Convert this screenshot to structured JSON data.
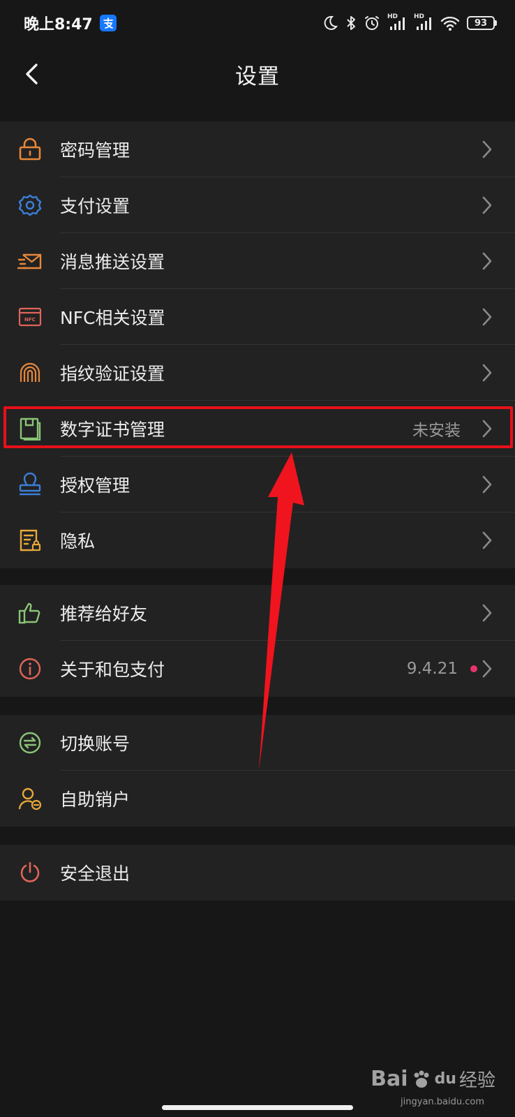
{
  "status_bar": {
    "time": "晚上8:47",
    "hd1": "HD",
    "hd2": "HD",
    "battery": "93"
  },
  "nav": {
    "title": "设置"
  },
  "sections": [
    {
      "items": [
        {
          "label": "密码管理",
          "icon": "lock-icon",
          "color": "#e8873a"
        },
        {
          "label": "支付设置",
          "icon": "gear-icon",
          "color": "#3b7fd9"
        },
        {
          "label": "消息推送设置",
          "icon": "message-send-icon",
          "color": "#e8873a"
        },
        {
          "label": "NFC相关设置",
          "icon": "nfc-card-icon",
          "color": "#e0645a",
          "icon_text": "NFC"
        },
        {
          "label": "指纹验证设置",
          "icon": "fingerprint-icon",
          "color": "#e8873a"
        },
        {
          "label": "数字证书管理",
          "icon": "certificate-icon",
          "color": "#8bc477",
          "value": "未安装"
        },
        {
          "label": "授权管理",
          "icon": "authorization-stamp-icon",
          "color": "#3b7fd9"
        },
        {
          "label": "隐私",
          "icon": "privacy-document-icon",
          "color": "#e8a83a"
        }
      ]
    },
    {
      "items": [
        {
          "label": "推荐给好友",
          "icon": "thumbs-up-icon",
          "color": "#8bc477"
        },
        {
          "label": "关于和包支付",
          "icon": "info-icon",
          "color": "#e0645a",
          "value": "9.4.21"
        }
      ]
    },
    {
      "items": [
        {
          "label": "切换账号",
          "icon": "switch-account-icon",
          "color": "#8bc477"
        },
        {
          "label": "自助销户",
          "icon": "user-remove-icon",
          "color": "#e8a83a"
        }
      ]
    },
    {
      "items": [
        {
          "label": "安全退出",
          "icon": "power-icon",
          "color": "#e0645a"
        }
      ]
    }
  ],
  "watermark": {
    "brand": "Bai",
    "brand_tail": "du",
    "product": "经验",
    "url": "jingyan.baidu.com"
  },
  "colors": {
    "background": "#171717",
    "row_background": "#222222",
    "highlight": "#e8101a",
    "new_dot": "#e8336b"
  }
}
